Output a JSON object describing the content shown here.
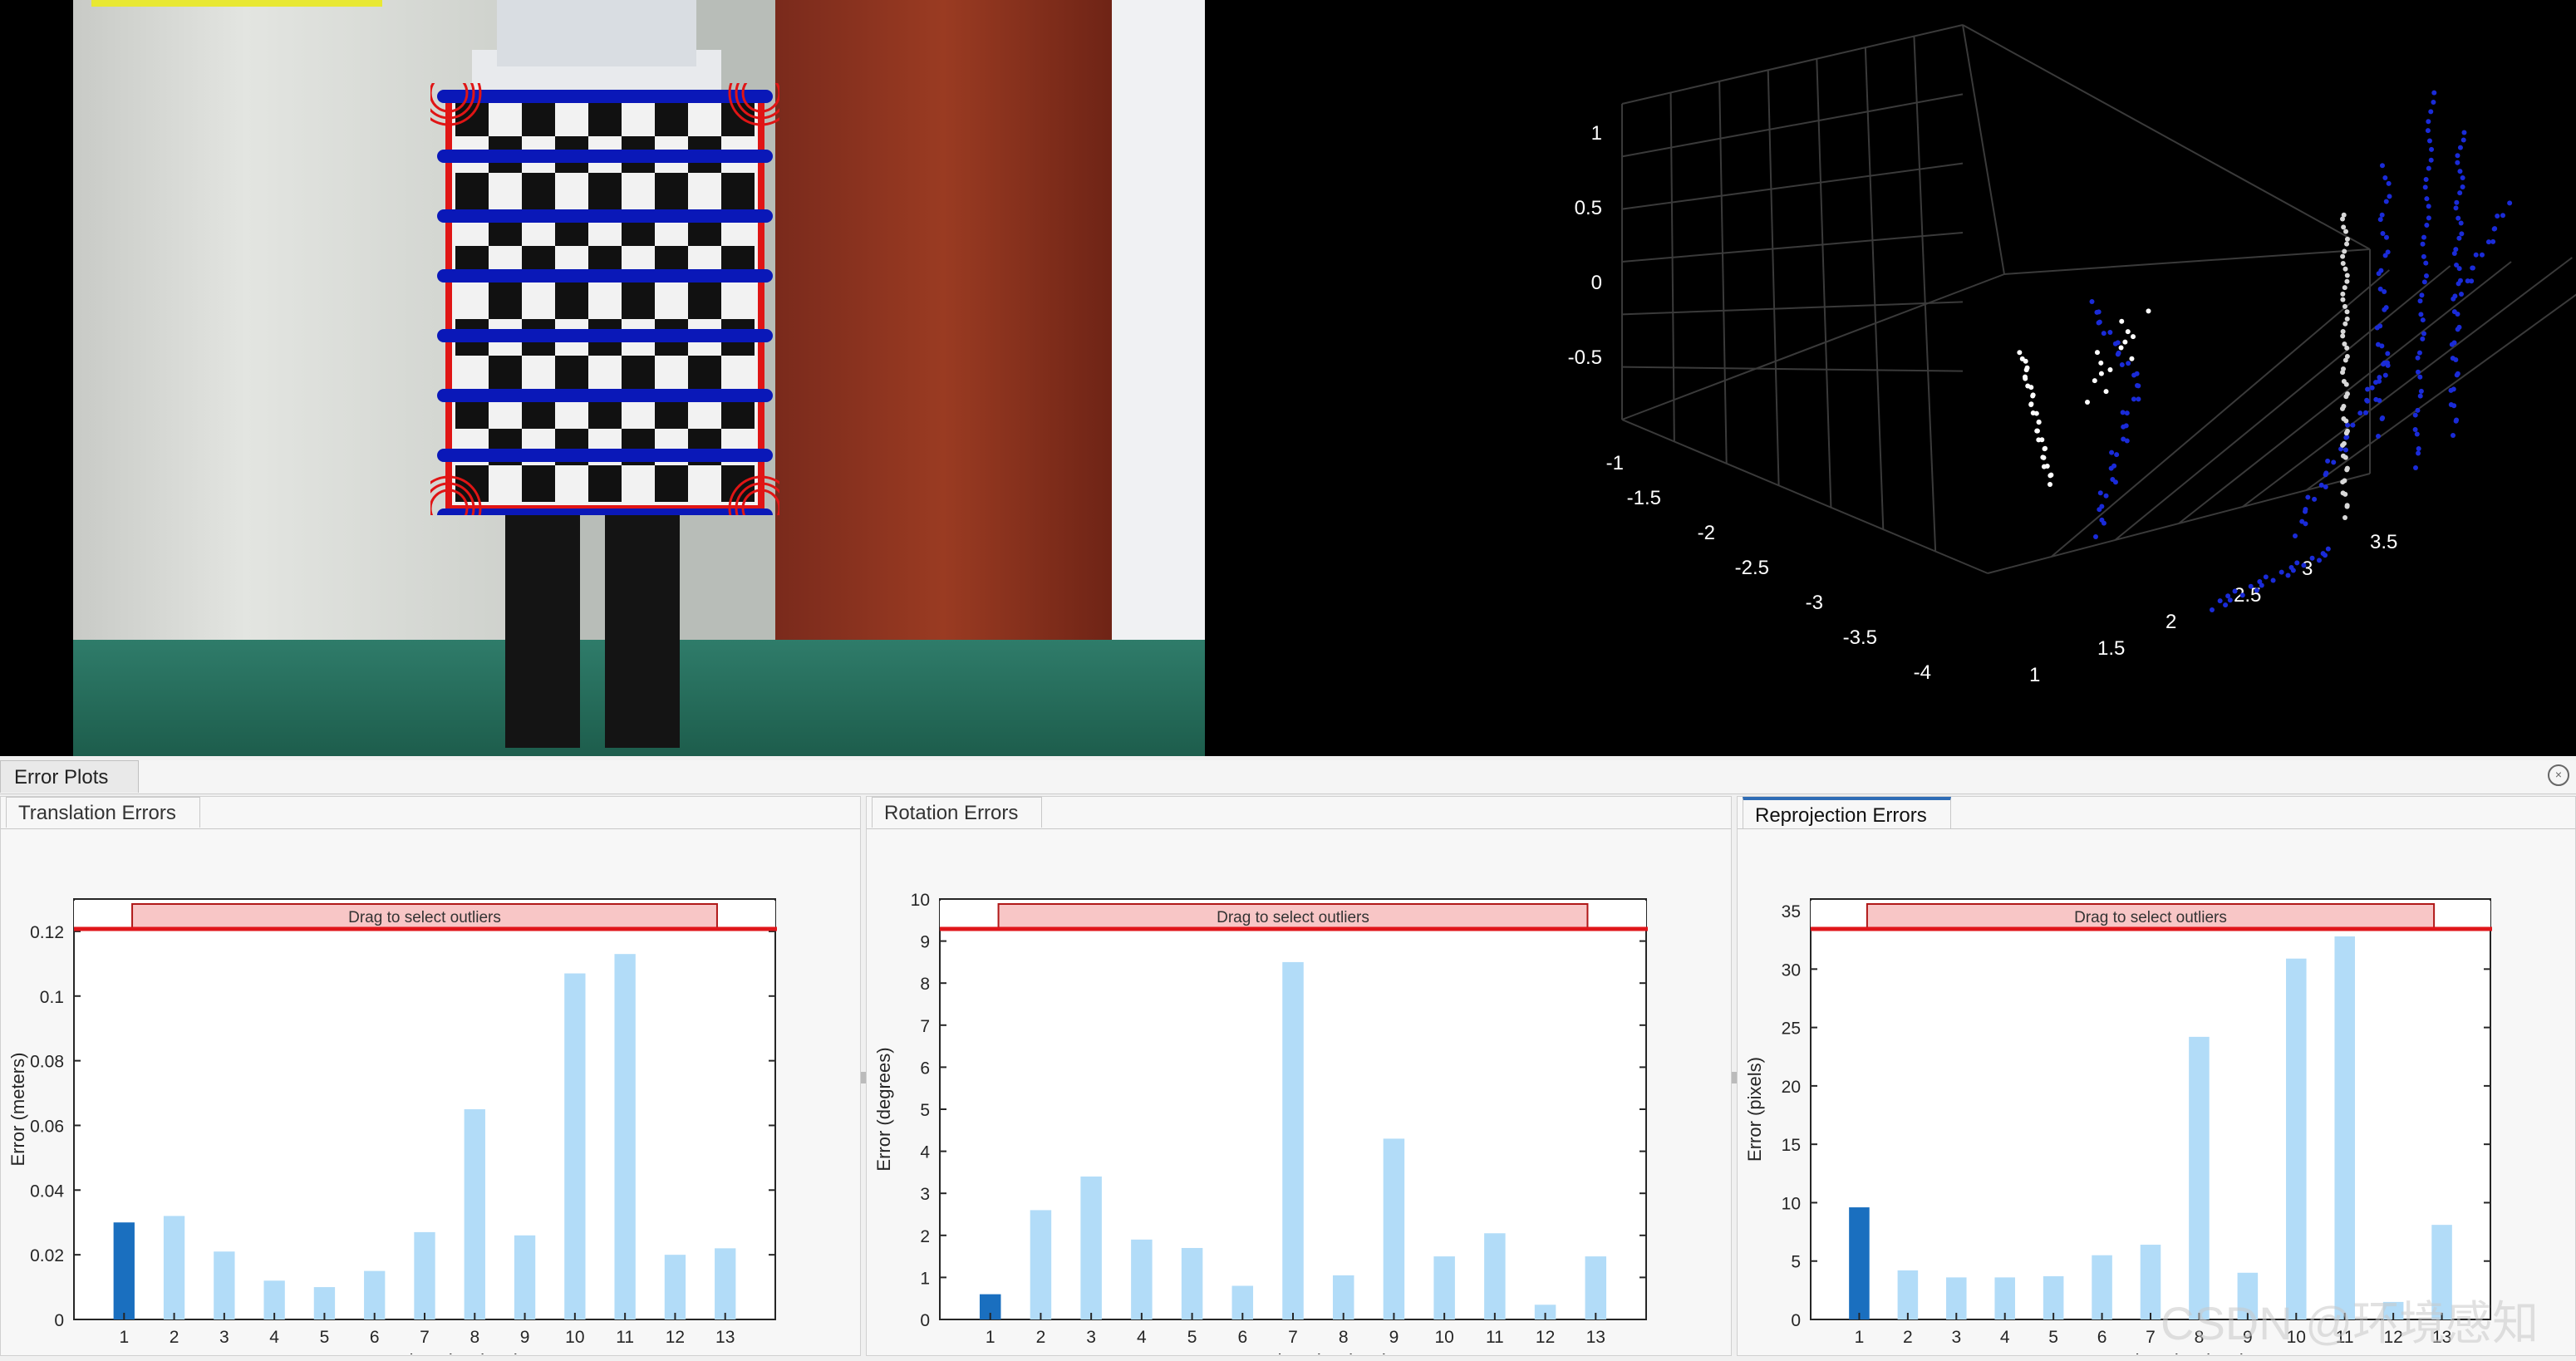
{
  "top_left_camera": {
    "description_hidden": ""
  },
  "point_cloud": {
    "z_ticks": [
      "1",
      "0.5",
      "0",
      "-0.5"
    ],
    "x_ticks": [
      "-1",
      "-1.5",
      "-2",
      "-2.5",
      "-3",
      "-3.5",
      "-4"
    ],
    "y_ticks": [
      "1",
      "1.5",
      "2",
      "2.5",
      "3",
      "3.5"
    ]
  },
  "panel": {
    "title": "Error Plots"
  },
  "plots": [
    {
      "tab": "Translation Errors",
      "outlier_label": "Drag to select outliers",
      "chart_data": {
        "type": "bar",
        "categories": [
          "1",
          "2",
          "3",
          "4",
          "5",
          "6",
          "7",
          "8",
          "9",
          "10",
          "11",
          "12",
          "13"
        ],
        "values": [
          0.03,
          0.032,
          0.021,
          0.012,
          0.01,
          0.015,
          0.027,
          0.065,
          0.026,
          0.107,
          0.113,
          0.02,
          0.022
        ],
        "selected_index": 0,
        "yticks": [
          "0",
          "0.02",
          "0.04",
          "0.06",
          "0.08",
          "0.1",
          "0.12"
        ],
        "ylim": [
          0,
          0.13
        ],
        "ylabel": "Error (meters)",
        "xlabel": "Image - Point Cloud Pairs"
      }
    },
    {
      "tab": "Rotation Errors",
      "outlier_label": "Drag to select outliers",
      "chart_data": {
        "type": "bar",
        "categories": [
          "1",
          "2",
          "3",
          "4",
          "5",
          "6",
          "7",
          "8",
          "9",
          "10",
          "11",
          "12",
          "13"
        ],
        "values": [
          0.6,
          2.6,
          3.4,
          1.9,
          1.7,
          0.8,
          8.5,
          1.05,
          4.3,
          1.5,
          2.05,
          0.35,
          1.5
        ],
        "selected_index": 0,
        "yticks": [
          "0",
          "1",
          "2",
          "3",
          "4",
          "5",
          "6",
          "7",
          "8",
          "9",
          "10"
        ],
        "ylim": [
          0,
          10
        ],
        "ylabel": "Error (degrees)",
        "xlabel": "Image - Point Cloud Pairs"
      }
    },
    {
      "tab": "Reprojection Errors",
      "outlier_label": "Drag to select outliers",
      "chart_data": {
        "type": "bar",
        "categories": [
          "1",
          "2",
          "3",
          "4",
          "5",
          "6",
          "7",
          "8",
          "9",
          "10",
          "11",
          "12",
          "13"
        ],
        "values": [
          9.6,
          4.2,
          3.6,
          3.6,
          3.7,
          5.5,
          6.4,
          24.2,
          4.0,
          30.9,
          32.8,
          1.5,
          8.1
        ],
        "selected_index": 0,
        "yticks": [
          "0",
          "5",
          "10",
          "15",
          "20",
          "25",
          "30",
          "35"
        ],
        "ylim": [
          0,
          36
        ],
        "ylabel": "Error (pixels)",
        "xlabel": "Image - Point Cloud Pairs"
      }
    }
  ],
  "watermark": "CSDN @环境感知",
  "colors": {
    "bar": "#b2dcf8",
    "bar_selected": "#1a6fbf",
    "outlier_line": "#e0161b",
    "outlier_box": "#f8c6c6"
  }
}
